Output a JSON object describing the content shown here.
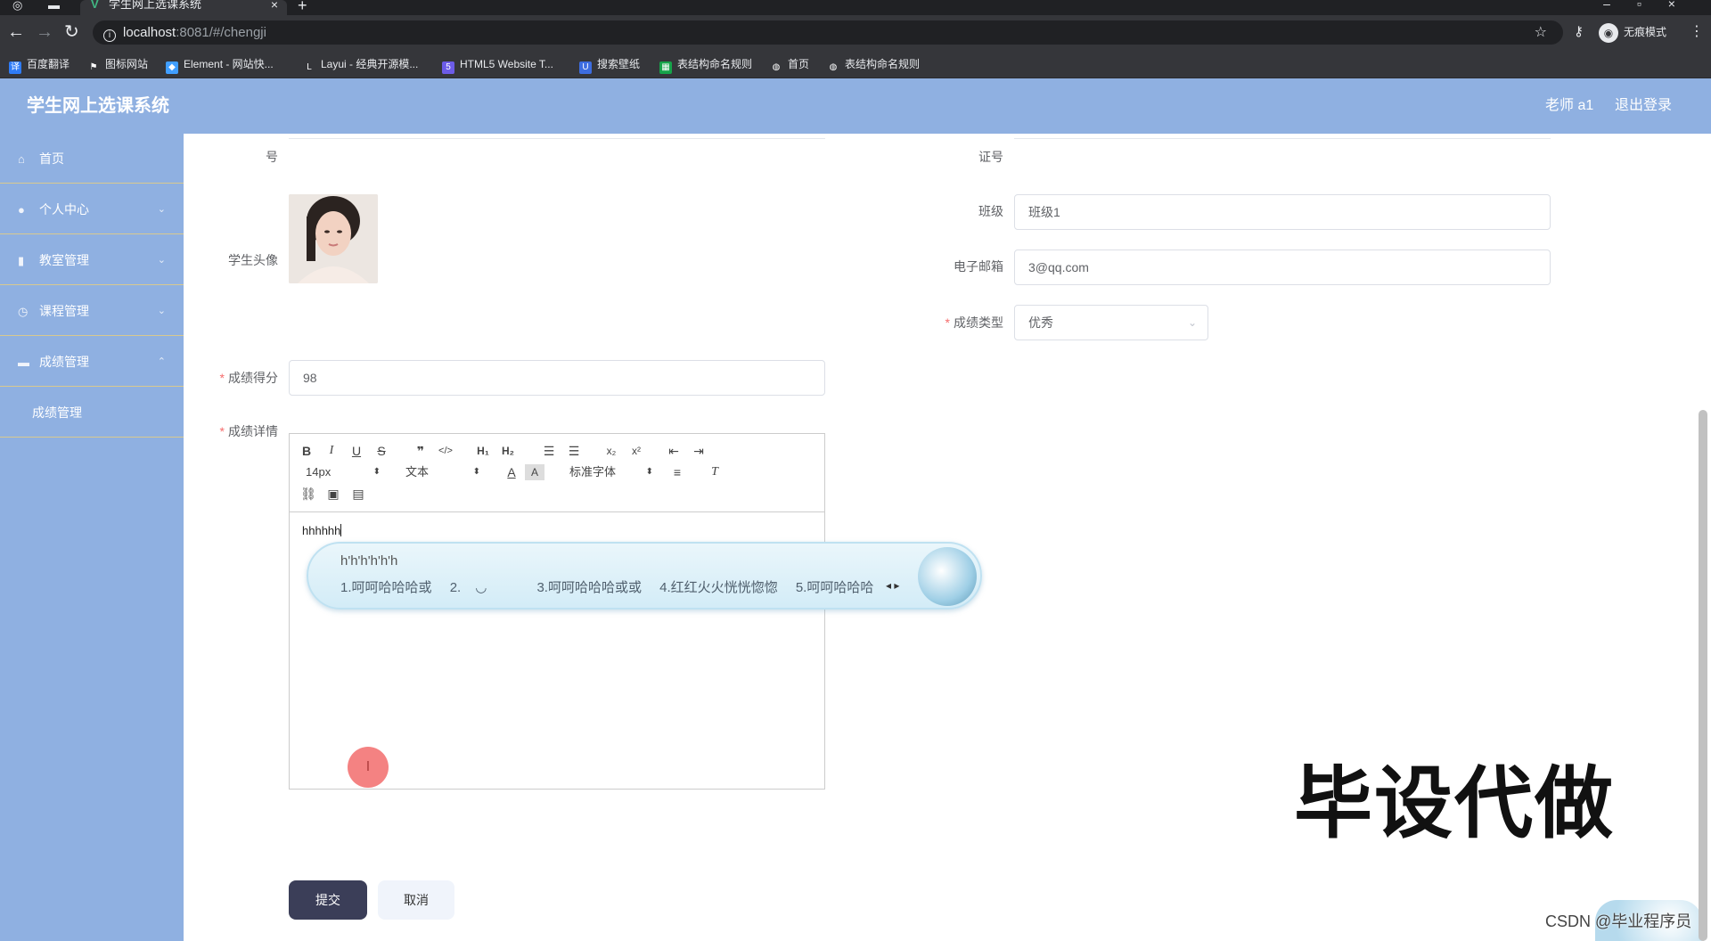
{
  "browser": {
    "tab_title": "学生网上选课系统",
    "tab_close": "×",
    "new_tab": "+",
    "url_host": "localhost",
    "url_path": ":8081/#/chengji",
    "incognito_label": "无痕模式",
    "bookmarks": [
      {
        "label": "百度翻译",
        "icon": "translate-icon",
        "color": "#2f7cf6"
      },
      {
        "label": "图标网站",
        "icon": "flag-icon",
        "color": "#35363a"
      },
      {
        "label": "Element - 网站快...",
        "icon": "element-icon",
        "color": "#409eff"
      },
      {
        "label": "Layui - 经典开源模...",
        "icon": "layui-icon",
        "color": "#35363a"
      },
      {
        "label": "HTML5 Website T...",
        "icon": "html5-icon",
        "color": "#6c5ce7"
      },
      {
        "label": "搜索壁纸",
        "icon": "wallpaper-icon",
        "color": "#3d6de0"
      },
      {
        "label": "表结构命名规则",
        "icon": "sheet-icon",
        "color": "#16a34a"
      },
      {
        "label": "首页",
        "icon": "globe-icon",
        "color": "#35363a"
      },
      {
        "label": "表结构命名规则",
        "icon": "globe-icon",
        "color": "#35363a"
      }
    ]
  },
  "header": {
    "title": "学生网上选课系统",
    "user": "老师 a1",
    "logout": "退出登录",
    "bg_color": "#8fb0e1"
  },
  "sidebar": {
    "items": [
      {
        "label": "首页",
        "icon": "home-icon"
      },
      {
        "label": "个人中心",
        "icon": "user-icon"
      },
      {
        "label": "教室管理",
        "icon": "chart-icon"
      },
      {
        "label": "课程管理",
        "icon": "clock-icon"
      },
      {
        "label": "成绩管理",
        "icon": "table-icon"
      }
    ],
    "sub_items": [
      {
        "label": "成绩管理"
      }
    ]
  },
  "form": {
    "left_top_label": "号",
    "right_top_label": "证号",
    "avatar_label": "学生头像",
    "class_label": "班级",
    "class_value": "班级1",
    "email_label": "电子邮箱",
    "email_value": "3@qq.com",
    "grade_type_label": "成绩类型",
    "grade_type_value": "优秀",
    "score_label": "成绩得分",
    "score_value": "98",
    "detail_label": "成绩详情",
    "required_mark": "*"
  },
  "editor": {
    "font_size": "14px",
    "text_type": "文本",
    "font_family": "标准字体",
    "content": "hhhhhh"
  },
  "ime": {
    "composition": "h'h'h'h'h'h",
    "candidates": [
      "1.呵呵哈哈哈或",
      "2.",
      "3.呵呵哈哈哈或或",
      "4.红红火火恍恍惚惚",
      "5.呵呵哈哈哈"
    ]
  },
  "buttons": {
    "submit": "提交",
    "cancel": "取消"
  },
  "overlay": {
    "watermark": "毕设代做",
    "csdn": "CSDN @毕业程序员",
    "cursor_glyph": "I"
  }
}
